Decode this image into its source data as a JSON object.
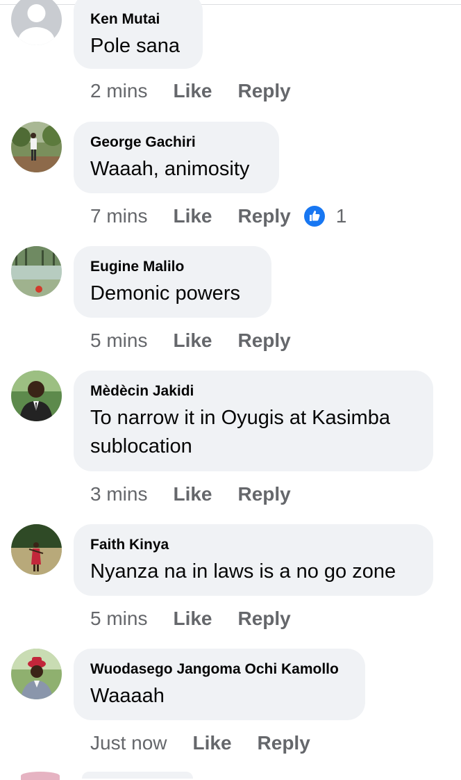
{
  "comments": [
    {
      "author": "Ken Mutai",
      "text": "Pole sana",
      "time": "2 mins",
      "like": "Like",
      "reply": "Reply"
    },
    {
      "author": "George Gachiri",
      "text": "Waaah, animosity",
      "time": "7 mins",
      "like": "Like",
      "reply": "Reply",
      "reaction_count": "1",
      "reaction_icon": "thumbs-up-icon",
      "reaction_color": "#1877f2"
    },
    {
      "author": "Eugine Malilo",
      "text": "Demonic powers",
      "time": "5 mins",
      "like": "Like",
      "reply": "Reply"
    },
    {
      "author": "Mèdècin Jakidi",
      "text": "To narrow it in Oyugis at Kasimba sublocation",
      "time": "3 mins",
      "like": "Like",
      "reply": "Reply"
    },
    {
      "author": "Faith Kinya",
      "text": "Nyanza na in laws is a no go zone",
      "time": "5 mins",
      "like": "Like",
      "reply": "Reply"
    },
    {
      "author": "Wuodasego Jangoma Ochi Kamollo",
      "text": "Waaaah",
      "time": "Just now",
      "like": "Like",
      "reply": "Reply"
    }
  ],
  "colors": {
    "bubble": "#f0f2f5",
    "meta": "#65676b",
    "text": "#050505",
    "reaction": "#1877f2"
  }
}
